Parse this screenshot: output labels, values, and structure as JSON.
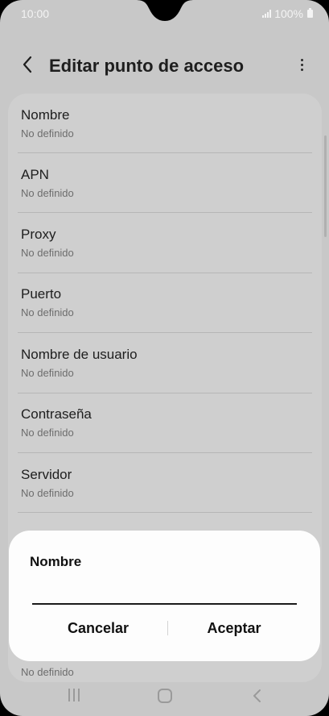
{
  "status_bar": {
    "time": "10:00",
    "battery": "100%"
  },
  "header": {
    "title": "Editar punto de acceso",
    "back_icon": "chevron-left-icon",
    "more_icon": "more-vertical-icon"
  },
  "list": {
    "items": [
      {
        "label": "Nombre",
        "value": "No definido"
      },
      {
        "label": "APN",
        "value": "No definido"
      },
      {
        "label": "Proxy",
        "value": "No definido"
      },
      {
        "label": "Puerto",
        "value": "No definido"
      },
      {
        "label": "Nombre de usuario",
        "value": "No definido"
      },
      {
        "label": "Contraseña",
        "value": "No definido"
      },
      {
        "label": "Servidor",
        "value": "No definido"
      }
    ],
    "peek_value": "No definido"
  },
  "dialog": {
    "title": "Nombre",
    "input_value": "",
    "cancel_label": "Cancelar",
    "accept_label": "Aceptar"
  },
  "nav_bar": {
    "recent_icon": "recent-apps-icon",
    "home_icon": "home-icon",
    "back_icon": "back-icon"
  },
  "colors": {
    "dimmed_background": "#c8c8c8",
    "dialog_background": "#fdfdfd",
    "text_primary": "#1e1e1e",
    "text_secondary": "#6d6d6d"
  }
}
